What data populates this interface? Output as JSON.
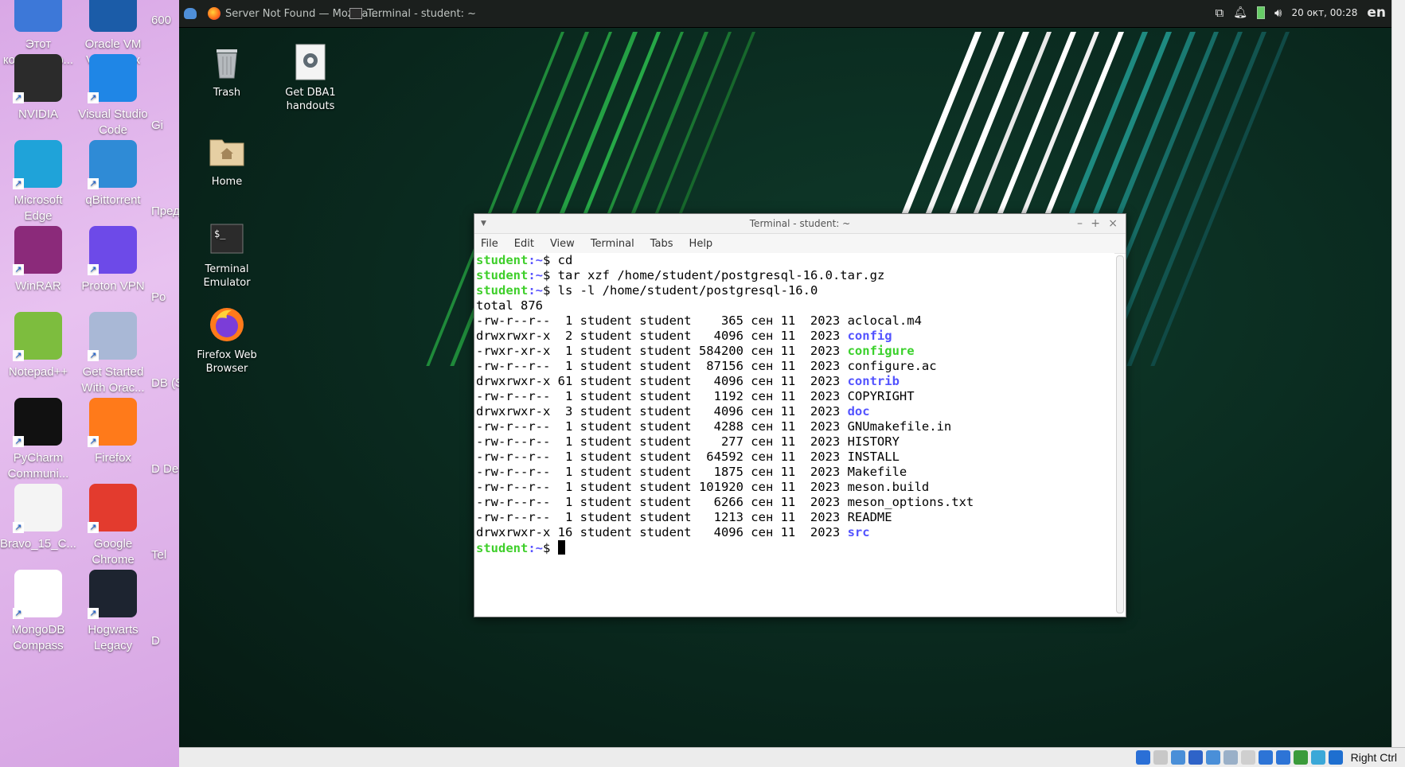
{
  "host_desktop": {
    "icons": [
      {
        "label": "Этот компьютер...",
        "name": "this-computer-icon",
        "color": "#3d78d8"
      },
      {
        "label": "Oracle VM VirtualBox",
        "name": "virtualbox-icon",
        "color": "#1b5ca8"
      },
      {
        "label": "NVIDIA",
        "name": "nvidia-icon",
        "color": "#2b2b2b"
      },
      {
        "label": "Visual Studio Code",
        "name": "vscode-icon",
        "color": "#1f86e6"
      },
      {
        "label": "Microsoft Edge",
        "name": "edge-icon",
        "color": "#1fa3d9"
      },
      {
        "label": "qBittorrent",
        "name": "qbittorrent-icon",
        "color": "#2f8bd6"
      },
      {
        "label": "WinRAR",
        "name": "winrar-icon",
        "color": "#8b2a7a"
      },
      {
        "label": "Proton VPN",
        "name": "protonvpn-icon",
        "color": "#6d4ae8"
      },
      {
        "label": "Notepad++",
        "name": "notepadpp-icon",
        "color": "#7dbd3e"
      },
      {
        "label": "Get Started With Orac...",
        "name": "oracle-xe-icon",
        "color": "#a9b8d6"
      },
      {
        "label": "PyCharm Communi...",
        "name": "pycharm-icon",
        "color": "#111111"
      },
      {
        "label": "Firefox",
        "name": "firefox-icon",
        "color": "#ff7a1a"
      },
      {
        "label": "Bravo_15_C...",
        "name": "document-icon",
        "color": "#f4f4f4"
      },
      {
        "label": "Google Chrome",
        "name": "chrome-icon",
        "color": "#e33b2e"
      },
      {
        "label": "MongoDB Compass",
        "name": "mongodb-compass-icon",
        "color": "#ffffff"
      },
      {
        "label": "Hogwarts Legacy",
        "name": "hogwarts-legacy-icon",
        "color": "#1d2430"
      }
    ],
    "partial_labels": [
      "600",
      "Gi",
      "Пред",
      "Po",
      "DB (S",
      "D De",
      "Tel",
      "D"
    ]
  },
  "guest_panel": {
    "tasks": [
      {
        "label": "Server Not Found — Mozilla ...",
        "name": "taskbar-firefox-window"
      },
      {
        "label": "Terminal - student: ~",
        "name": "taskbar-terminal-window"
      }
    ],
    "datetime": "20 окт, 00:28",
    "language": "en"
  },
  "guest_desktop": {
    "icons": [
      {
        "label": "Trash",
        "name": "trash-icon"
      },
      {
        "label": "Get DBA1 handouts",
        "name": "settings-script-icon"
      },
      {
        "label": "Home",
        "name": "home-folder-icon"
      },
      {
        "label": "Terminal Emulator",
        "name": "terminal-emulator-icon"
      },
      {
        "label": "Firefox Web Browser",
        "name": "firefox-web-browser-icon"
      }
    ]
  },
  "terminal": {
    "title": "Terminal - student: ~",
    "menu": [
      "File",
      "Edit",
      "View",
      "Terminal",
      "Tabs",
      "Help"
    ],
    "lines": [
      {
        "type": "prompt",
        "user": "student",
        "path": ":~$",
        "cmd": " cd"
      },
      {
        "type": "prompt",
        "user": "student",
        "path": ":~$",
        "cmd": " tar xzf /home/student/postgresql-16.0.tar.gz"
      },
      {
        "type": "prompt",
        "user": "student",
        "path": ":~$",
        "cmd": " ls -l /home/student/postgresql-16.0"
      },
      {
        "type": "text",
        "text": "total 876"
      },
      {
        "type": "ls",
        "prefix": "-rw-r--r--  1 student student    365 сен 11  2023 ",
        "file": "aclocal.m4",
        "kind": "file"
      },
      {
        "type": "ls",
        "prefix": "drwxrwxr-x  2 student student   4096 сен 11  2023 ",
        "file": "config",
        "kind": "dir"
      },
      {
        "type": "ls",
        "prefix": "-rwxr-xr-x  1 student student 584200 сен 11  2023 ",
        "file": "configure",
        "kind": "exec"
      },
      {
        "type": "ls",
        "prefix": "-rw-r--r--  1 student student  87156 сен 11  2023 ",
        "file": "configure.ac",
        "kind": "file"
      },
      {
        "type": "ls",
        "prefix": "drwxrwxr-x 61 student student   4096 сен 11  2023 ",
        "file": "contrib",
        "kind": "dir"
      },
      {
        "type": "ls",
        "prefix": "-rw-r--r--  1 student student   1192 сен 11  2023 ",
        "file": "COPYRIGHT",
        "kind": "file"
      },
      {
        "type": "ls",
        "prefix": "drwxrwxr-x  3 student student   4096 сен 11  2023 ",
        "file": "doc",
        "kind": "dir"
      },
      {
        "type": "ls",
        "prefix": "-rw-r--r--  1 student student   4288 сен 11  2023 ",
        "file": "GNUmakefile.in",
        "kind": "file"
      },
      {
        "type": "ls",
        "prefix": "-rw-r--r--  1 student student    277 сен 11  2023 ",
        "file": "HISTORY",
        "kind": "file"
      },
      {
        "type": "ls",
        "prefix": "-rw-r--r--  1 student student  64592 сен 11  2023 ",
        "file": "INSTALL",
        "kind": "file"
      },
      {
        "type": "ls",
        "prefix": "-rw-r--r--  1 student student   1875 сен 11  2023 ",
        "file": "Makefile",
        "kind": "file"
      },
      {
        "type": "ls",
        "prefix": "-rw-r--r--  1 student student 101920 сен 11  2023 ",
        "file": "meson.build",
        "kind": "file"
      },
      {
        "type": "ls",
        "prefix": "-rw-r--r--  1 student student   6266 сен 11  2023 ",
        "file": "meson_options.txt",
        "kind": "file"
      },
      {
        "type": "ls",
        "prefix": "-rw-r--r--  1 student student   1213 сен 11  2023 ",
        "file": "README",
        "kind": "file"
      },
      {
        "type": "ls",
        "prefix": "drwxrwxr-x 16 student student   4096 сен 11  2023 ",
        "file": "src",
        "kind": "dir"
      },
      {
        "type": "prompt",
        "user": "student",
        "path": ":~$",
        "cmd": " ",
        "cursor": true
      }
    ]
  },
  "vm_statusbar": {
    "host_key": "Right Ctrl",
    "status_icon_colors": [
      "#2a6fd6",
      "#c8c8c8",
      "#4a8fd8",
      "#2e63c8",
      "#4a8fd8",
      "#9ab0c8",
      "#cfcfcf",
      "#2d74d6",
      "#2d74d6",
      "#3b9b3b",
      "#3ba8d8",
      "#1e6fd0"
    ]
  },
  "colors": {
    "prompt_user": "#3fcf2b",
    "prompt_path": "#5a55ff",
    "dir": "#5353ff",
    "exec": "#3bd12c"
  }
}
